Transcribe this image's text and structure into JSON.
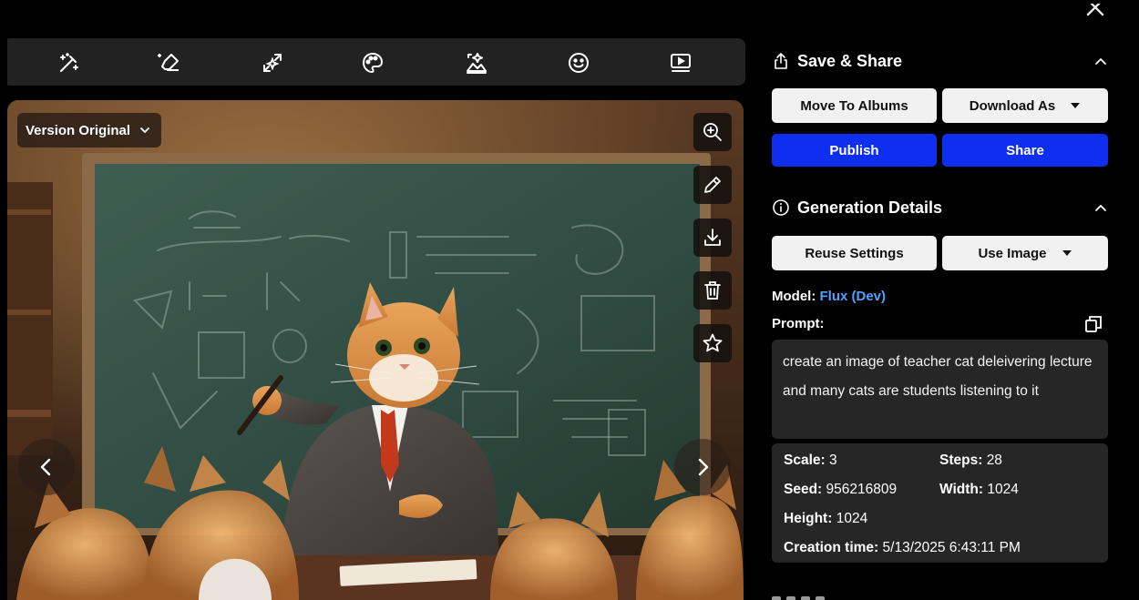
{
  "toolbar": {
    "tools": [
      "magic-wand-icon",
      "eraser-icon",
      "expand-icon",
      "palette-icon",
      "image-sparkle-icon",
      "smiley-icon",
      "video-play-icon"
    ]
  },
  "viewer": {
    "version_label": "Version Original",
    "side_tools": [
      "zoom-in-icon",
      "pencil-icon",
      "download-icon",
      "trash-icon",
      "star-icon"
    ]
  },
  "save_share": {
    "title": "Save & Share",
    "move_to_albums": "Move To Albums",
    "download_as": "Download As",
    "publish": "Publish",
    "share": "Share"
  },
  "generation": {
    "title": "Generation Details",
    "reuse_settings": "Reuse Settings",
    "use_image": "Use Image",
    "model_label": "Model:",
    "model_value": "Flux (Dev)",
    "prompt_label": "Prompt:",
    "prompt_text": "create an image of teacher cat deleivering lecture and many cats are students listening to it",
    "scale_label": "Scale:",
    "scale_value": "3",
    "steps_label": "Steps:",
    "steps_value": "28",
    "seed_label": "Seed:",
    "seed_value": "956216809",
    "width_label": "Width:",
    "width_value": "1024",
    "height_label": "Height:",
    "height_value": "1024",
    "creation_label": "Creation time:",
    "creation_value": "5/13/2025 6:43:11 PM"
  },
  "colors": {
    "accent_blue": "#0f2ff0",
    "model_link": "#4ea1ff",
    "panel_box": "#262626",
    "toolbar_bg": "#222222"
  }
}
